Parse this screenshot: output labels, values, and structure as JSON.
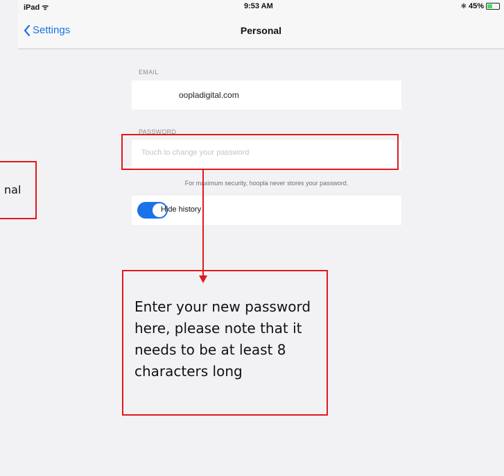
{
  "status_bar": {
    "carrier": "iPad ᯤ",
    "time": "9:53 AM",
    "bluetooth_icon": "bluetooth-icon",
    "battery_percent": "45%",
    "battery_level": 0.45
  },
  "nav": {
    "back_label": "Settings",
    "title": "Personal"
  },
  "email": {
    "label": "EMAIL",
    "value": "oopladigital.com"
  },
  "password": {
    "label": "PASSWORD",
    "placeholder": "Touch to change your password",
    "note": "For maximum security, hoopla never stores your password."
  },
  "history": {
    "label": "Hide history",
    "enabled": true
  },
  "annotations": {
    "left_fragment": "nal",
    "callout": "Enter your new password here, please note that it needs to be at least 8 characters long",
    "color": "#e0191c"
  },
  "colors": {
    "accent": "#1a73e8",
    "background": "#f2f2f4"
  }
}
